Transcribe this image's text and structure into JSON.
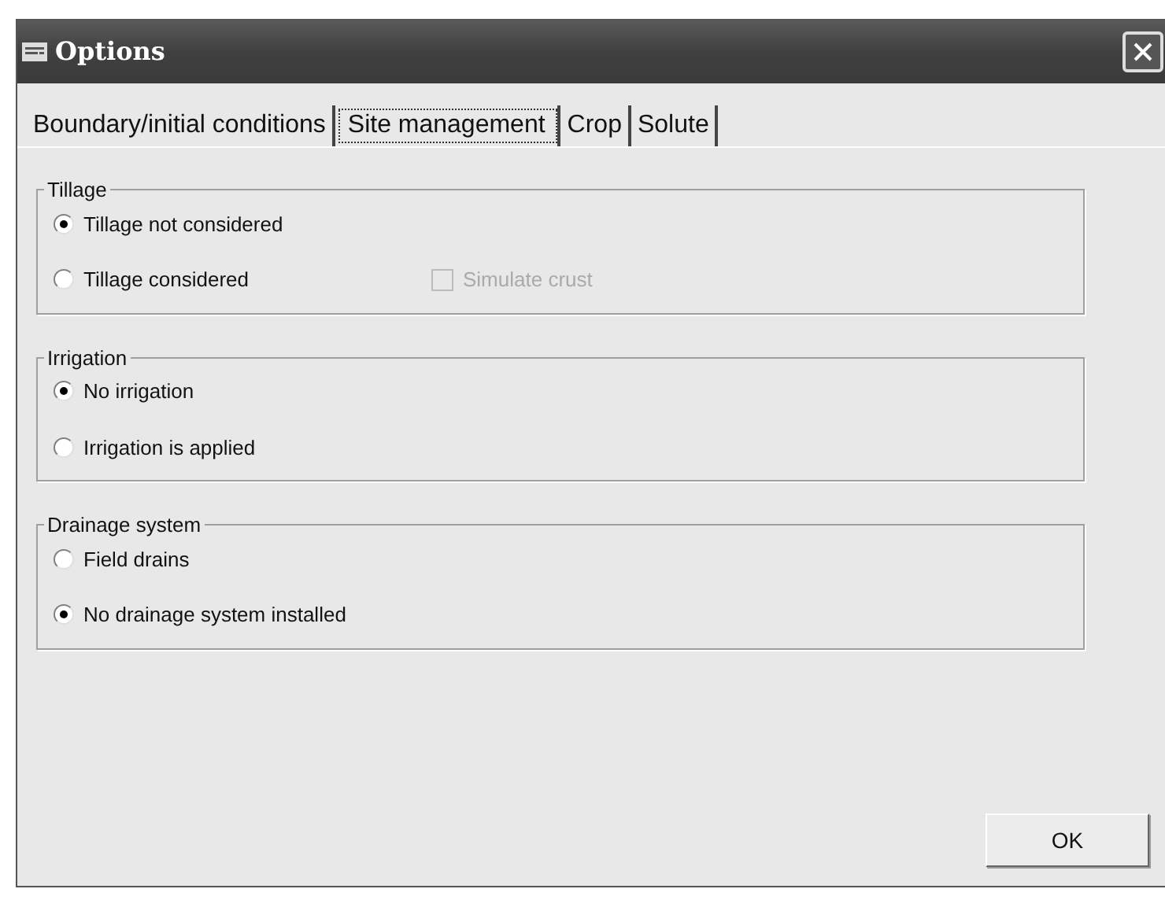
{
  "window": {
    "title": "Options"
  },
  "tabs": [
    {
      "label": "Boundary/initial conditions",
      "selected": false
    },
    {
      "label": "Site management",
      "selected": true
    },
    {
      "label": "Crop",
      "selected": false
    },
    {
      "label": "Solute",
      "selected": false
    }
  ],
  "groups": [
    {
      "title": "Tillage",
      "options": [
        {
          "label": "Tillage not considered",
          "selected": true
        },
        {
          "label": "Tillage considered",
          "selected": false
        }
      ],
      "checkbox": {
        "label": "Simulate crust",
        "checked": false,
        "disabled": true
      }
    },
    {
      "title": "Irrigation",
      "options": [
        {
          "label": "No irrigation",
          "selected": true
        },
        {
          "label": "Irrigation is applied",
          "selected": false
        }
      ]
    },
    {
      "title": "Drainage system",
      "options": [
        {
          "label": "Field drains",
          "selected": false
        },
        {
          "label": "No drainage system installed",
          "selected": true
        }
      ]
    }
  ],
  "ok_button": {
    "label": "OK"
  }
}
